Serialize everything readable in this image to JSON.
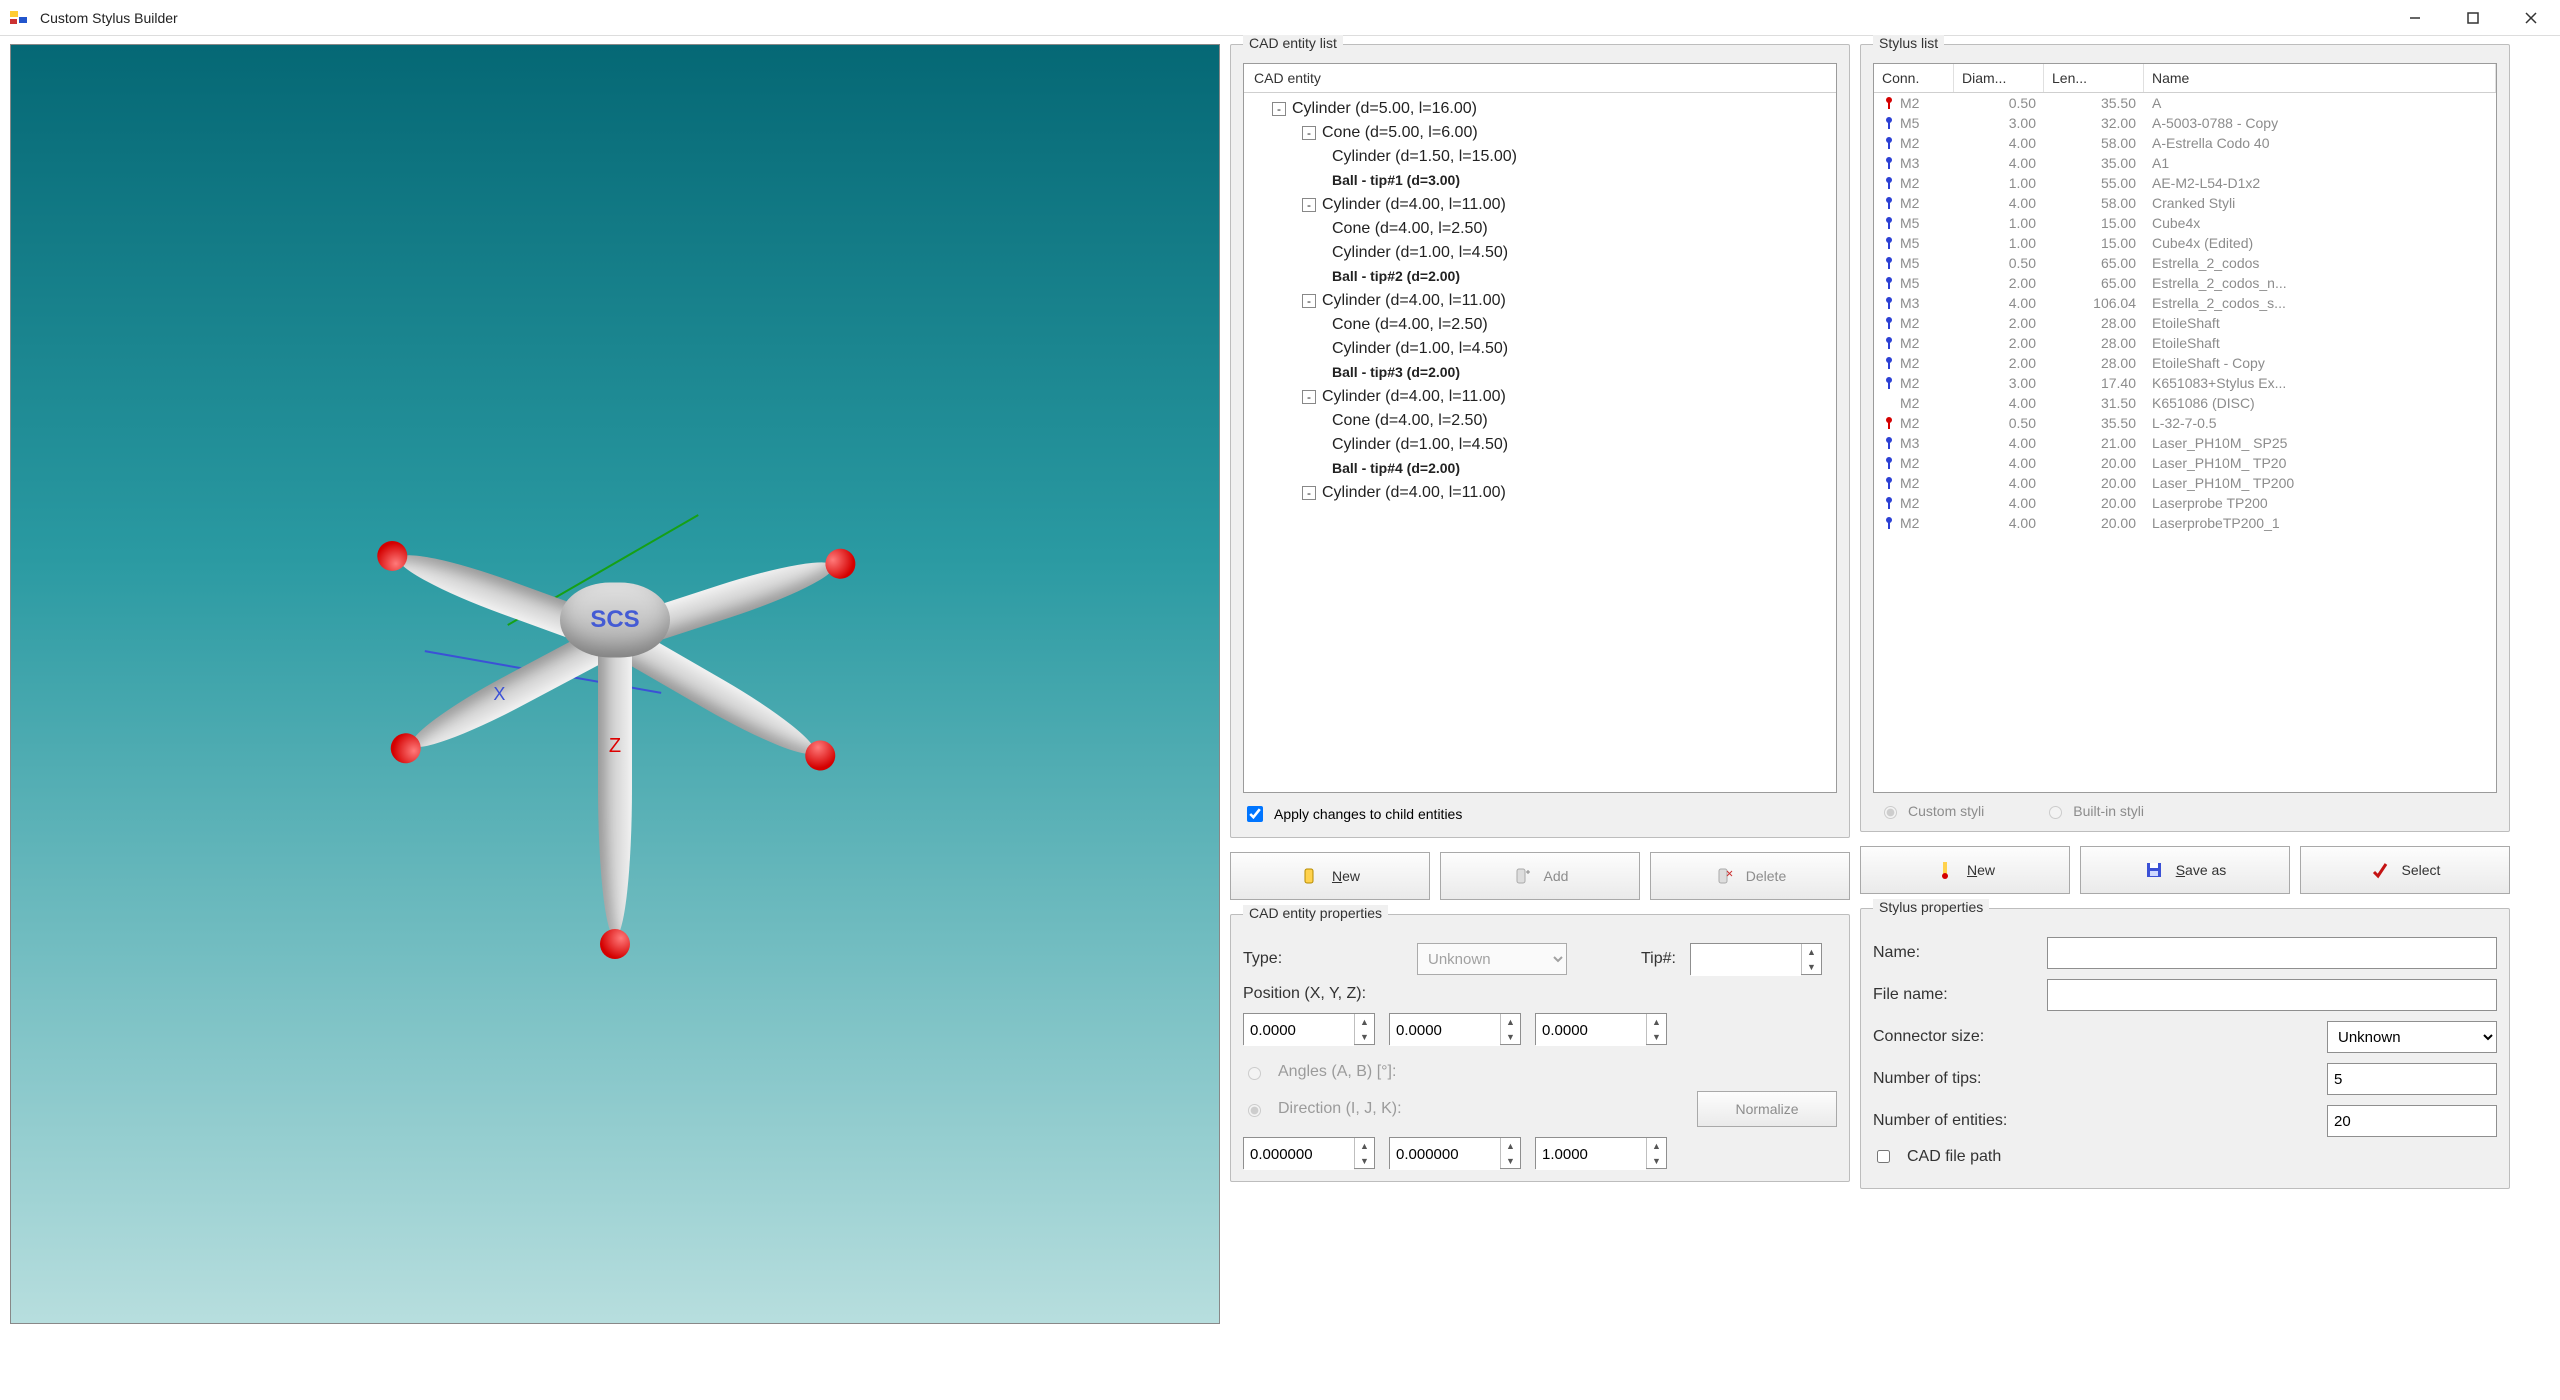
{
  "window": {
    "title": "Custom Stylus Builder"
  },
  "cad_list": {
    "legend": "CAD entity list",
    "header": "CAD entity",
    "tree": [
      {
        "depth": 1,
        "expand": "-",
        "text": "Cylinder (d=5.00, l=16.00)",
        "bold": false
      },
      {
        "depth": 2,
        "expand": "-",
        "text": "Cone (d=5.00, l=6.00)",
        "bold": false
      },
      {
        "depth": 3,
        "expand": "",
        "text": "Cylinder (d=1.50, l=15.00)",
        "bold": false
      },
      {
        "depth": 3,
        "expand": "",
        "text": "Ball - tip#1 (d=3.00)",
        "bold": true
      },
      {
        "depth": 2,
        "expand": "-",
        "text": "Cylinder (d=4.00, l=11.00)",
        "bold": false
      },
      {
        "depth": 3,
        "expand": "",
        "text": "Cone (d=4.00, l=2.50)",
        "bold": false
      },
      {
        "depth": 3,
        "expand": "",
        "text": "Cylinder (d=1.00, l=4.50)",
        "bold": false
      },
      {
        "depth": 3,
        "expand": "",
        "text": "Ball - tip#2 (d=2.00)",
        "bold": true
      },
      {
        "depth": 2,
        "expand": "-",
        "text": "Cylinder (d=4.00, l=11.00)",
        "bold": false
      },
      {
        "depth": 3,
        "expand": "",
        "text": "Cone (d=4.00, l=2.50)",
        "bold": false
      },
      {
        "depth": 3,
        "expand": "",
        "text": "Cylinder (d=1.00, l=4.50)",
        "bold": false
      },
      {
        "depth": 3,
        "expand": "",
        "text": "Ball - tip#3 (d=2.00)",
        "bold": true
      },
      {
        "depth": 2,
        "expand": "-",
        "text": "Cylinder (d=4.00, l=11.00)",
        "bold": false
      },
      {
        "depth": 3,
        "expand": "",
        "text": "Cone (d=4.00, l=2.50)",
        "bold": false
      },
      {
        "depth": 3,
        "expand": "",
        "text": "Cylinder (d=1.00, l=4.50)",
        "bold": false
      },
      {
        "depth": 3,
        "expand": "",
        "text": "Ball - tip#4 (d=2.00)",
        "bold": true
      },
      {
        "depth": 2,
        "expand": "-",
        "text": "Cylinder (d=4.00, l=11.00)",
        "bold": false
      }
    ],
    "apply_children": "Apply changes to child entities",
    "buttons": {
      "new": "New",
      "add": "Add",
      "delete": "Delete"
    }
  },
  "cad_props": {
    "legend": "CAD entity properties",
    "type_label": "Type:",
    "type_value": "Unknown",
    "tip_label": "Tip#:",
    "tip_value": "",
    "position_label": "Position (X, Y, Z):",
    "pos_x": "0.0000",
    "pos_y": "0.0000",
    "pos_z": "0.0000",
    "angles_label": "Angles (A, B) [°]:",
    "direction_label": "Direction (I, J, K):",
    "normalize": "Normalize",
    "dir_i": "0.000000",
    "dir_j": "0.000000",
    "dir_k": "1.0000"
  },
  "stylus_list": {
    "legend": "Stylus list",
    "headers": {
      "conn": "Conn.",
      "diam": "Diam...",
      "len": "Len...",
      "name": "Name"
    },
    "rows": [
      {
        "icon": "red",
        "conn": "M2",
        "diam": "0.50",
        "len": "35.50",
        "name": "A"
      },
      {
        "icon": "blue",
        "conn": "M5",
        "diam": "3.00",
        "len": "32.00",
        "name": "A-5003-0788 - Copy"
      },
      {
        "icon": "blue",
        "conn": "M2",
        "diam": "4.00",
        "len": "58.00",
        "name": "A-Estrella Codo 40"
      },
      {
        "icon": "blue",
        "conn": "M3",
        "diam": "4.00",
        "len": "35.00",
        "name": "A1"
      },
      {
        "icon": "blue",
        "conn": "M2",
        "diam": "1.00",
        "len": "55.00",
        "name": "AE-M2-L54-D1x2"
      },
      {
        "icon": "blue",
        "conn": "M2",
        "diam": "4.00",
        "len": "58.00",
        "name": "Cranked Styli"
      },
      {
        "icon": "blue",
        "conn": "M5",
        "diam": "1.00",
        "len": "15.00",
        "name": "Cube4x"
      },
      {
        "icon": "blue",
        "conn": "M5",
        "diam": "1.00",
        "len": "15.00",
        "name": "Cube4x (Edited)"
      },
      {
        "icon": "blue",
        "conn": "M5",
        "diam": "0.50",
        "len": "65.00",
        "name": "Estrella_2_codos"
      },
      {
        "icon": "blue",
        "conn": "M5",
        "diam": "2.00",
        "len": "65.00",
        "name": "Estrella_2_codos_n..."
      },
      {
        "icon": "blue",
        "conn": "M3",
        "diam": "4.00",
        "len": "106.04",
        "name": "Estrella_2_codos_s..."
      },
      {
        "icon": "blue",
        "conn": "M2",
        "diam": "2.00",
        "len": "28.00",
        "name": "EtoileShaft"
      },
      {
        "icon": "blue",
        "conn": "M2",
        "diam": "2.00",
        "len": "28.00",
        "name": "EtoileShaft"
      },
      {
        "icon": "blue",
        "conn": "M2",
        "diam": "2.00",
        "len": "28.00",
        "name": "EtoileShaft - Copy"
      },
      {
        "icon": "blue",
        "conn": "M2",
        "diam": "3.00",
        "len": "17.40",
        "name": "K651083+Stylus Ex..."
      },
      {
        "icon": "none",
        "conn": "M2",
        "diam": "4.00",
        "len": "31.50",
        "name": "K651086 (DISC)"
      },
      {
        "icon": "red",
        "conn": "M2",
        "diam": "0.50",
        "len": "35.50",
        "name": "L-32-7-0.5"
      },
      {
        "icon": "blue",
        "conn": "M3",
        "diam": "4.00",
        "len": "21.00",
        "name": "Laser_PH10M_ SP25"
      },
      {
        "icon": "blue",
        "conn": "M2",
        "diam": "4.00",
        "len": "20.00",
        "name": "Laser_PH10M_ TP20"
      },
      {
        "icon": "blue",
        "conn": "M2",
        "diam": "4.00",
        "len": "20.00",
        "name": "Laser_PH10M_ TP200"
      },
      {
        "icon": "blue",
        "conn": "M2",
        "diam": "4.00",
        "len": "20.00",
        "name": "Laserprobe TP200"
      },
      {
        "icon": "blue",
        "conn": "M2",
        "diam": "4.00",
        "len": "20.00",
        "name": "LaserprobeTP200_1"
      }
    ],
    "radio_custom": "Custom styli",
    "radio_builtin": "Built-in styli",
    "buttons": {
      "new": "New",
      "saveas": "Save as",
      "select": "Select"
    }
  },
  "stylus_props": {
    "legend": "Stylus properties",
    "name_label": "Name:",
    "name_value": "",
    "file_label": "File name:",
    "file_value": "",
    "connector_label": "Connector size:",
    "connector_value": "Unknown",
    "tips_label": "Number of tips:",
    "tips_value": "5",
    "entities_label": "Number of entities:",
    "entities_value": "20",
    "cadpath_label": "CAD file path"
  },
  "viewport_labels": {
    "scs": "SCS",
    "z": "Z",
    "x": "X"
  }
}
